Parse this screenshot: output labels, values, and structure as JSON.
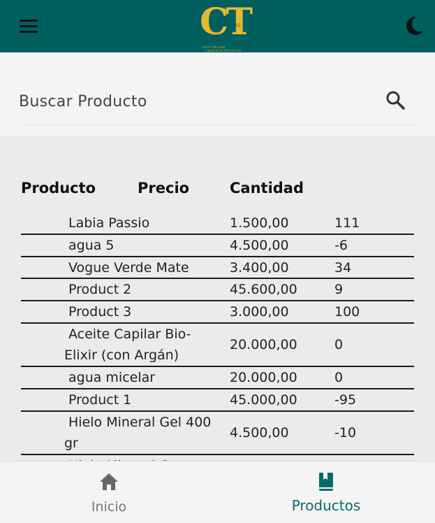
{
  "header": {
    "logo_letters": "CT",
    "logo_word": "COSMETIC",
    "logo_sub1": "SOFTWARE",
    "logo_sub2": "ADMINISTRATIVO",
    "brand_color": "#005f5f",
    "accent_color": "#e6b82e",
    "menu_icon": "hamburger-icon",
    "theme_icon": "moon-icon"
  },
  "search": {
    "placeholder": "Buscar Producto",
    "icon": "search-icon"
  },
  "table": {
    "headers": [
      "Producto",
      "Precio",
      "Cantidad"
    ],
    "rows": [
      {
        "name": "Labia Passio",
        "price": "1.500,00",
        "qty": "111"
      },
      {
        "name": "agua 5",
        "price": "4.500,00",
        "qty": "-6"
      },
      {
        "name": "Vogue Verde Mate",
        "price": "3.400,00",
        "qty": "34"
      },
      {
        "name": "Product 2",
        "price": "45.600,00",
        "qty": "9"
      },
      {
        "name": "Product 3",
        "price": "3.000,00",
        "qty": "100"
      },
      {
        "name": "Aceite Capilar Bio-Elixir (con Argán)",
        "price": "20.000,00",
        "qty": "0"
      },
      {
        "name": "agua micelar",
        "price": "20.000,00",
        "qty": "0"
      },
      {
        "name": "Product 1",
        "price": "45.000,00",
        "qty": "-95"
      },
      {
        "name": "Hielo Mineral Gel 400 gr",
        "price": "4.500,00",
        "qty": "-10"
      },
      {
        "name": "Hielo Mineral C...",
        "price": "",
        "qty": ""
      }
    ]
  },
  "bottom_nav": {
    "items": [
      {
        "label": "Inicio",
        "icon": "home-icon",
        "active": false
      },
      {
        "label": "Productos",
        "icon": "book-icon",
        "active": true
      }
    ]
  }
}
